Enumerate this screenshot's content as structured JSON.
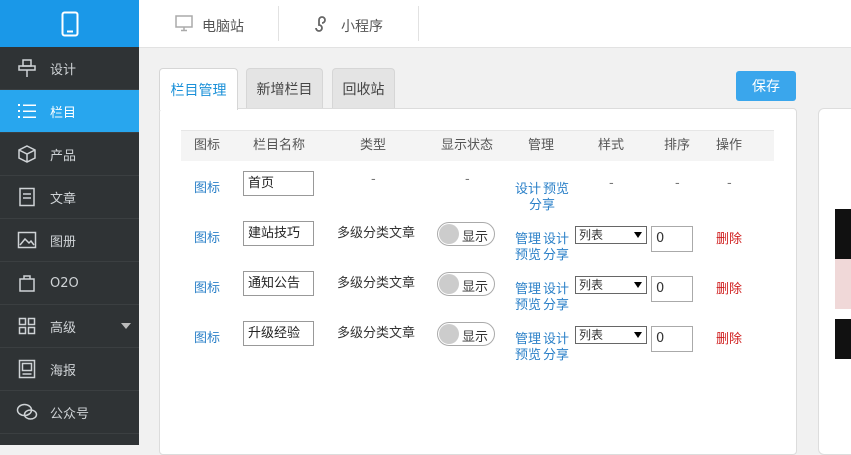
{
  "sidebar": {
    "items": [
      {
        "label": "设计",
        "icon": "design-icon"
      },
      {
        "label": "栏目",
        "icon": "list-icon"
      },
      {
        "label": "产品",
        "icon": "box-icon"
      },
      {
        "label": "文章",
        "icon": "document-icon"
      },
      {
        "label": "图册",
        "icon": "image-icon"
      },
      {
        "label": "O2O",
        "icon": "bag-icon"
      },
      {
        "label": "高级",
        "icon": "grid-icon"
      },
      {
        "label": "海报",
        "icon": "poster-icon"
      },
      {
        "label": "公众号",
        "icon": "wechat-icon"
      }
    ],
    "active_index": 1
  },
  "topbar": {
    "desktop_label": "电脑站",
    "miniapp_label": "小程序"
  },
  "tabs": {
    "manage": "栏目管理",
    "add": "新增栏目",
    "recycle": "回收站"
  },
  "save_label": "保存",
  "table": {
    "headers": [
      "图标",
      "栏目名称",
      "类型",
      "显示状态",
      "管理",
      "样式",
      "排序",
      "操作"
    ],
    "rows": [
      {
        "icon": "图标",
        "name": "首页",
        "type": "-",
        "status": "-",
        "manage1": "设计",
        "manage2": "预览",
        "manage3": "分享",
        "style": "-",
        "order": "-",
        "action": "-"
      },
      {
        "icon": "图标",
        "name": "建站技巧",
        "type": "多级分类文章",
        "status": "显示",
        "manage1": "管理",
        "manage2": "设计",
        "manage3": "预览",
        "manage4": "分享",
        "style": "列表",
        "order": "0",
        "action": "删除"
      },
      {
        "icon": "图标",
        "name": "通知公告",
        "type": "多级分类文章",
        "status": "显示",
        "manage1": "管理",
        "manage2": "设计",
        "manage3": "预览",
        "manage4": "分享",
        "style": "列表",
        "order": "0",
        "action": "删除"
      },
      {
        "icon": "图标",
        "name": "升级经验",
        "type": "多级分类文章",
        "status": "显示",
        "manage1": "管理",
        "manage2": "设计",
        "manage3": "预览",
        "manage4": "分享",
        "style": "列表",
        "order": "0",
        "action": "删除"
      }
    ]
  },
  "colors": {
    "sidebar_bg": "#2f3335",
    "accent": "#28a6ee",
    "link": "#2b80c8",
    "delete": "#d02020"
  }
}
